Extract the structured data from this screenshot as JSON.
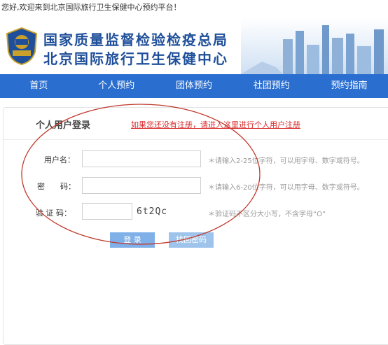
{
  "topbar": {
    "welcome": "您好,欢迎来到北京国际旅行卫生保健中心预约平台！"
  },
  "header": {
    "line1": "国家质量监督检验检疫总局",
    "line2": "北京国际旅行卫生保健中心"
  },
  "nav": {
    "items": [
      "首页",
      "个人预约",
      "团体预约",
      "社团预约",
      "预约指南"
    ]
  },
  "login": {
    "title": "个人用户登录",
    "register_link": "如果您还没有注册，请进入这里进行个人用户注册",
    "username_label": "用户名：",
    "username_value": "",
    "username_hint": "＊请输入2-25位字符，可以用字母、数字或符号。",
    "password_label": "密　　码：",
    "password_value": "",
    "password_hint": "＊请输入6-20位字符，可以用字母、数字或符号。",
    "captcha_label": "验 证 码：",
    "captcha_value": "",
    "captcha_text": "6t2Qc",
    "captcha_hint": "＊验证码不区分大小写，不含字母“O”",
    "login_button": "登 录",
    "recover_button": "找回密码"
  },
  "colors": {
    "nav_bg": "#2a6ed0",
    "brand_text": "#1f4f9a",
    "link_red": "#d9292b",
    "annotation_oval": "#c0392b"
  }
}
